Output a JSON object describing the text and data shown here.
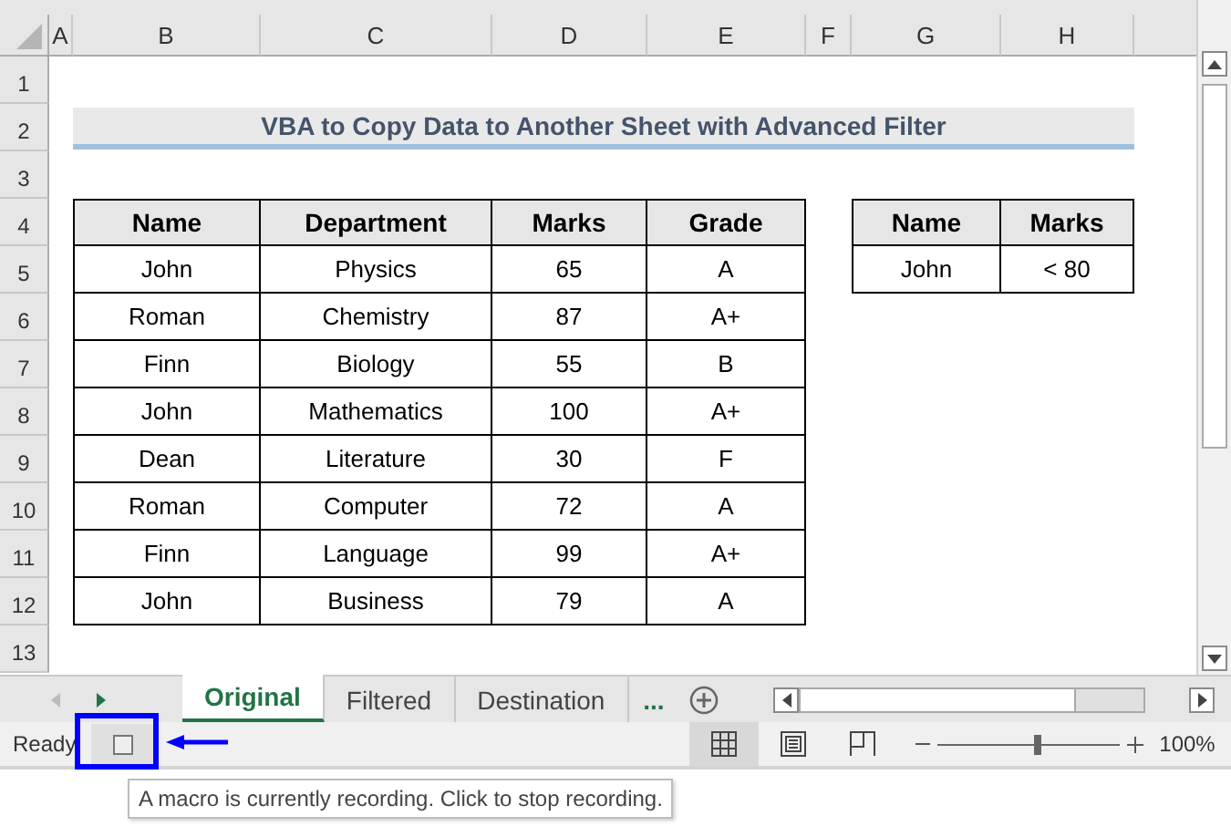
{
  "column_headers": [
    "A",
    "B",
    "C",
    "D",
    "E",
    "F",
    "G",
    "H"
  ],
  "row_headers": [
    "1",
    "2",
    "3",
    "4",
    "5",
    "6",
    "7",
    "8",
    "9",
    "10",
    "11",
    "12",
    "13"
  ],
  "title": "VBA to Copy Data to Another Sheet with Advanced Filter",
  "table": {
    "columns": [
      "Name",
      "Department",
      "Marks",
      "Grade"
    ],
    "rows": [
      [
        "John",
        "Physics",
        "65",
        "A"
      ],
      [
        "Roman",
        "Chemistry",
        "87",
        "A+"
      ],
      [
        "Finn",
        "Biology",
        "55",
        "B"
      ],
      [
        "John",
        "Mathematics",
        "100",
        "A+"
      ],
      [
        "Dean",
        "Literature",
        "30",
        "F"
      ],
      [
        "Roman",
        "Computer",
        "72",
        "A"
      ],
      [
        "Finn",
        "Language",
        "99",
        "A+"
      ],
      [
        "John",
        "Business",
        "79",
        "A"
      ]
    ]
  },
  "criteria": {
    "columns": [
      "Name",
      "Marks"
    ],
    "rows": [
      [
        "John",
        "< 80"
      ]
    ]
  },
  "sheet_tabs": [
    {
      "label": "Original",
      "selected": true
    },
    {
      "label": "Filtered",
      "selected": false
    },
    {
      "label": "Destination",
      "selected": false
    }
  ],
  "more_tabs": "...",
  "status_bar": {
    "mode": "Ready",
    "view_buttons": [
      {
        "kind": "normal",
        "selected": true
      },
      {
        "kind": "layout",
        "selected": false
      },
      {
        "kind": "pagebreak",
        "selected": false
      }
    ],
    "zoom": {
      "level": 0.55,
      "reading": "100%"
    }
  },
  "tooltip": "A macro is currently recording. Click to stop recording."
}
